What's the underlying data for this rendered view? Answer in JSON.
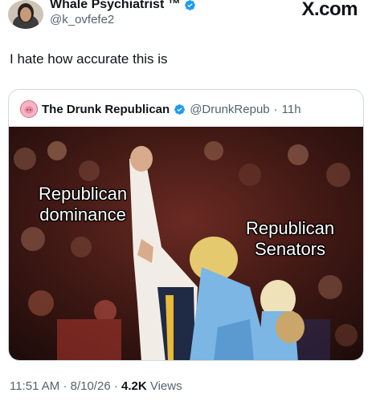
{
  "tweet": {
    "author_name": "Whale Psychiatrist ™",
    "handle": "@k_ovfefe2",
    "text": "I hate how accurate this is",
    "brand": "X.com"
  },
  "quoted": {
    "author_name": "The Drunk Republican",
    "handle": "@DrunkRepub",
    "separator": "·",
    "time": "11h",
    "meme": {
      "caption_left": "Republican dominance",
      "caption_right": "Republican Senators"
    }
  },
  "meta": {
    "time": "11:51 AM",
    "separator": "·",
    "date": "8/10/26",
    "views_count": "4.2K",
    "views_label": "Views"
  },
  "colors": {
    "verified": "#1d9bf0",
    "secondary_text": "#536471"
  },
  "icons": [
    "verified-badge-icon",
    "x-logo"
  ]
}
